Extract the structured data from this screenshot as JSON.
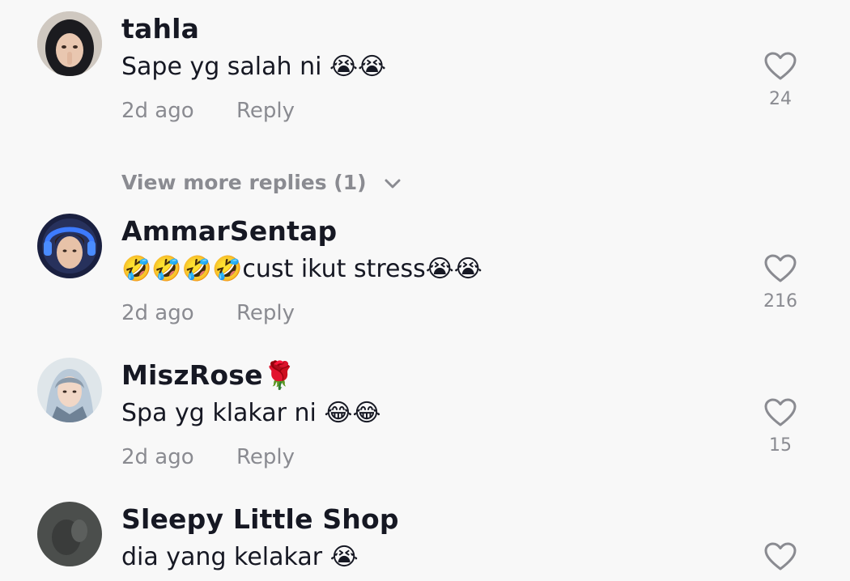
{
  "comments": [
    {
      "username": "tahla",
      "text": "Sape yg salah ni 😭😭",
      "time": "2d ago",
      "reply_label": "Reply",
      "likes": "24",
      "view_more": "View more replies (1)"
    },
    {
      "username": "AmmarSentap",
      "text": "🤣🤣🤣🤣cust ikut stress😭😭",
      "time": "2d ago",
      "reply_label": "Reply",
      "likes": "216"
    },
    {
      "username": "MiszRose🌹",
      "text": "Spa yg klakar ni 😂😂",
      "time": "2d ago",
      "reply_label": "Reply",
      "likes": "15"
    },
    {
      "username": "Sleepy Little Shop",
      "text": "dia yang kelakar 😭",
      "time": "",
      "reply_label": "",
      "likes": ""
    }
  ],
  "colors": {
    "background": "#f8f8f8",
    "primary_text": "#161823",
    "secondary_text": "#8a8b91",
    "icon": "#8a8b91"
  },
  "icons": {
    "like": "heart-outline-icon",
    "expand": "chevron-down-icon"
  }
}
